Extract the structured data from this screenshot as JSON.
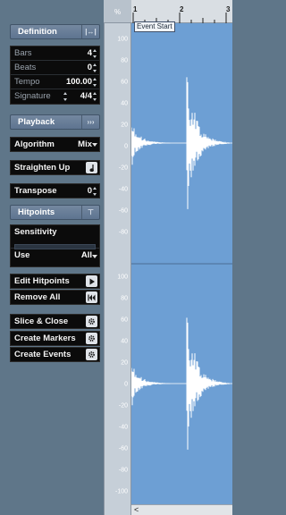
{
  "definition": {
    "header": "Definition",
    "bars_label": "Bars",
    "bars_value": "4",
    "beats_label": "Beats",
    "beats_value": "0",
    "tempo_label": "Tempo",
    "tempo_value": "100.00",
    "signature_label": "Signature",
    "signature_value": "4/4"
  },
  "playback": {
    "header": "Playback",
    "algorithm_label": "Algorithm",
    "algorithm_value": "Mix",
    "straighten_label": "Straighten Up",
    "transpose_label": "Transpose",
    "transpose_value": "0"
  },
  "hitpoints": {
    "header": "Hitpoints",
    "sensitivity_label": "Sensitivity",
    "use_label": "Use",
    "use_value": "All",
    "edit_label": "Edit Hitpoints",
    "remove_label": "Remove All",
    "slice_label": "Slice & Close",
    "markers_label": "Create Markers",
    "events_label": "Create Events"
  },
  "editor": {
    "scale_unit": "%",
    "ruler_marks": [
      "1",
      "2",
      "3"
    ],
    "event_start_label": "Event Start",
    "scale_ticks_top": [
      "100",
      "80",
      "60",
      "40",
      "20",
      "0",
      "-20",
      "-40",
      "-60",
      "-80"
    ],
    "scale_ticks_bottom": [
      "100",
      "80",
      "60",
      "40",
      "20",
      "0",
      "-20",
      "-40",
      "-60",
      "-80",
      "-100"
    ],
    "waveform_color": "#ffffff",
    "background_color": "#6d9fd4"
  }
}
